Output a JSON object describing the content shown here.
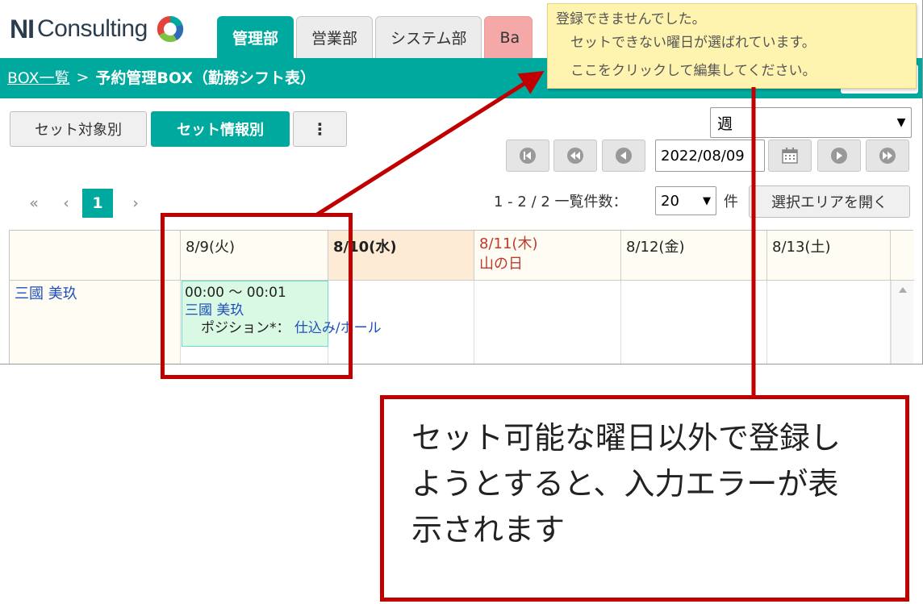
{
  "header": {
    "logo_ni": "NI",
    "logo_text": "Consulting",
    "tabs": [
      {
        "label": "管理部",
        "active": true
      },
      {
        "label": "営業部",
        "active": false
      },
      {
        "label": "システム部",
        "active": false
      },
      {
        "label": "Ba",
        "active": false
      }
    ]
  },
  "breadcrumb": {
    "link": "BOX一覧",
    "sep": ">",
    "current": "予約管理BOX（勤務シフト表）"
  },
  "view_toggle": {
    "by_target": "セット対象別",
    "by_info": "セット情報別",
    "more": "⋮"
  },
  "period_select": {
    "value": "週"
  },
  "date_input": {
    "value": "2022/08/09"
  },
  "pager": {
    "first": "«",
    "prev": "‹",
    "current": "1",
    "next": "›"
  },
  "list_count": {
    "text": "1 - 2 / 2 一覧件数：",
    "per_page": "20",
    "unit": "件"
  },
  "open_area_button": "選択エリアを開く",
  "calendar": {
    "days": [
      {
        "label": "8/9(火)",
        "sub": ""
      },
      {
        "label": "8/10(水)",
        "sub": ""
      },
      {
        "label": "8/11(木)",
        "sub": "山の日"
      },
      {
        "label": "8/12(金)",
        "sub": ""
      },
      {
        "label": "8/13(土)",
        "sub": ""
      }
    ],
    "row_name": "三國 美玖",
    "entry": {
      "time": "00:00 ～ 00:01",
      "name": "三國 美玖",
      "position_label": "ポジション*：",
      "position_value": "仕込み/ホール"
    }
  },
  "error_tooltip": {
    "line1": "登録できませんでした。",
    "line2": "セットできない曜日が選ばれています。",
    "line3": "ここをクリックして編集してください。"
  },
  "callout": {
    "line1": "セット可能な曜日以外で登録し",
    "line2": "ようとすると、入力エラーが表",
    "line3": "示されます"
  },
  "colors": {
    "brand_teal": "#00a99d",
    "annotation_red": "#c00000",
    "tooltip_yellow": "#fff3b0",
    "holiday_red": "#c0392b",
    "today_bg": "#fdebd6"
  }
}
